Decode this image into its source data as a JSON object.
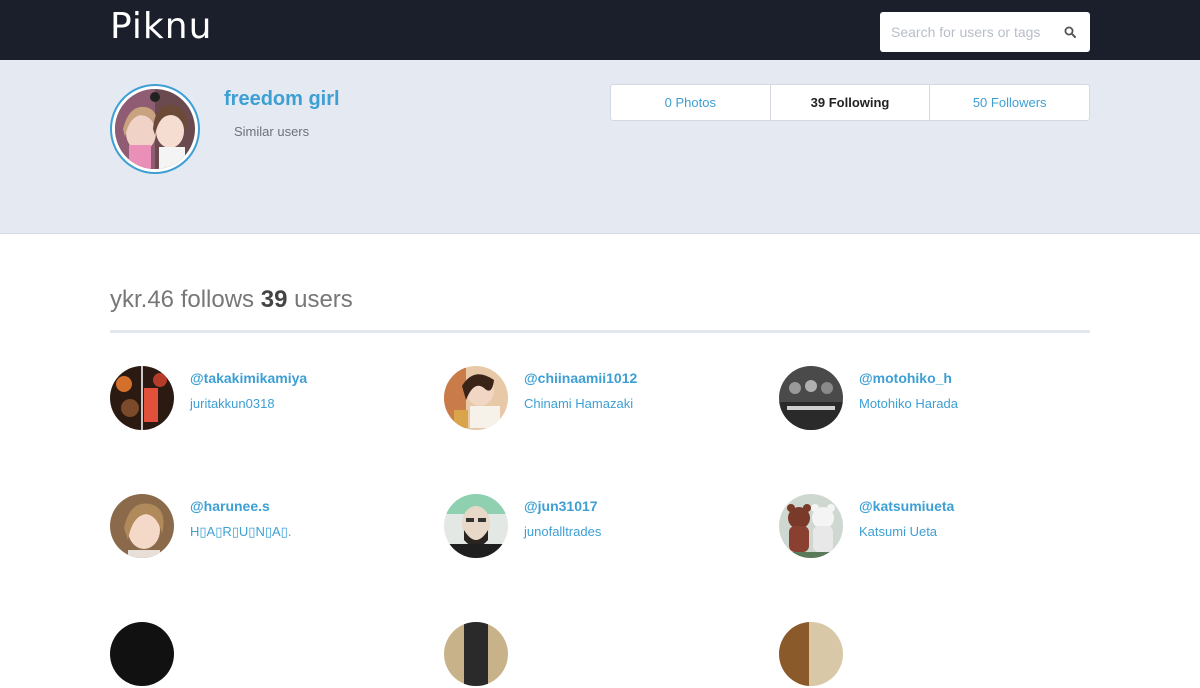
{
  "header": {
    "logo": "Piknu",
    "search_placeholder": "Search for users or tags"
  },
  "profile": {
    "name": "freedom girl",
    "similar_label": "Similar users"
  },
  "stats": [
    {
      "label": "0 Photos",
      "active": false
    },
    {
      "label": "39 Following",
      "active": true
    },
    {
      "label": "50 Followers",
      "active": false
    }
  ],
  "follows": {
    "prefix": "ykr.46 follows ",
    "count": "39",
    "suffix": " users"
  },
  "users": [
    {
      "handle": "@takakimikamiya",
      "name": "juritakkun0318"
    },
    {
      "handle": "@chiinaamii1012",
      "name": "Chinami Hamazaki"
    },
    {
      "handle": "@motohiko_h",
      "name": "Motohiko Harada"
    },
    {
      "handle": "@harunee.s",
      "name": "H▯A▯R▯U▯N▯A▯."
    },
    {
      "handle": "@jun31017",
      "name": "junofalltrades"
    },
    {
      "handle": "@katsumiueta",
      "name": "Katsumi Ueta"
    }
  ],
  "colors": {
    "topbar": "#1a1f2b",
    "accent": "#3d9fd4",
    "band": "#e5e9f1"
  }
}
